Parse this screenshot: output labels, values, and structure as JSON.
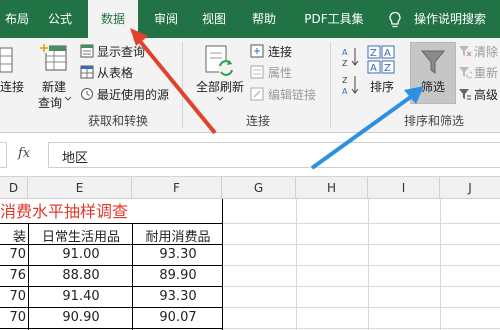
{
  "tabs": [
    {
      "label": "布局",
      "active": false
    },
    {
      "label": "公式",
      "active": false
    },
    {
      "label": "数据",
      "active": true
    },
    {
      "label": "审阅",
      "active": false
    },
    {
      "label": "视图",
      "active": false
    },
    {
      "label": "帮助",
      "active": false
    },
    {
      "label": "PDF工具集",
      "active": false
    }
  ],
  "tell_me": "操作说明搜索",
  "ribbon": {
    "get_transform": {
      "group_label": "获取和转换",
      "partial_left": "连接",
      "new_query_line1": "新建",
      "new_query_line2": "查询",
      "show_queries": "显示查询",
      "from_table": "从表格",
      "recent_sources": "最近使用的源"
    },
    "connections": {
      "group_label": "连接",
      "refresh_all": "全部刷新",
      "connections": "连接",
      "properties": "属性",
      "edit_links": "编辑链接"
    },
    "sort_filter": {
      "group_label": "排序和筛选",
      "sort": "排序",
      "filter": "筛选",
      "clear": "清除",
      "reapply": "重新",
      "advanced": "高级"
    }
  },
  "formula_bar": {
    "fx": "fx",
    "value": "地区"
  },
  "columns": [
    "D",
    "E",
    "F",
    "G",
    "H",
    "I",
    "J"
  ],
  "sheet": {
    "title": "消费水平抽样调查",
    "headers": [
      "装",
      "日常生活用品",
      "耐用消费品"
    ],
    "rows": [
      [
        "70",
        "91.00",
        "93.30"
      ],
      [
        "76",
        "88.80",
        "89.90"
      ],
      [
        "70",
        "91.40",
        "93.30"
      ],
      [
        "70",
        "90.90",
        "90.07"
      ]
    ]
  },
  "colors": {
    "ribbon_green": "#217346",
    "title_red": "#e03a2d",
    "arrow_red": "#e0422e",
    "arrow_blue": "#2f8fe0"
  }
}
